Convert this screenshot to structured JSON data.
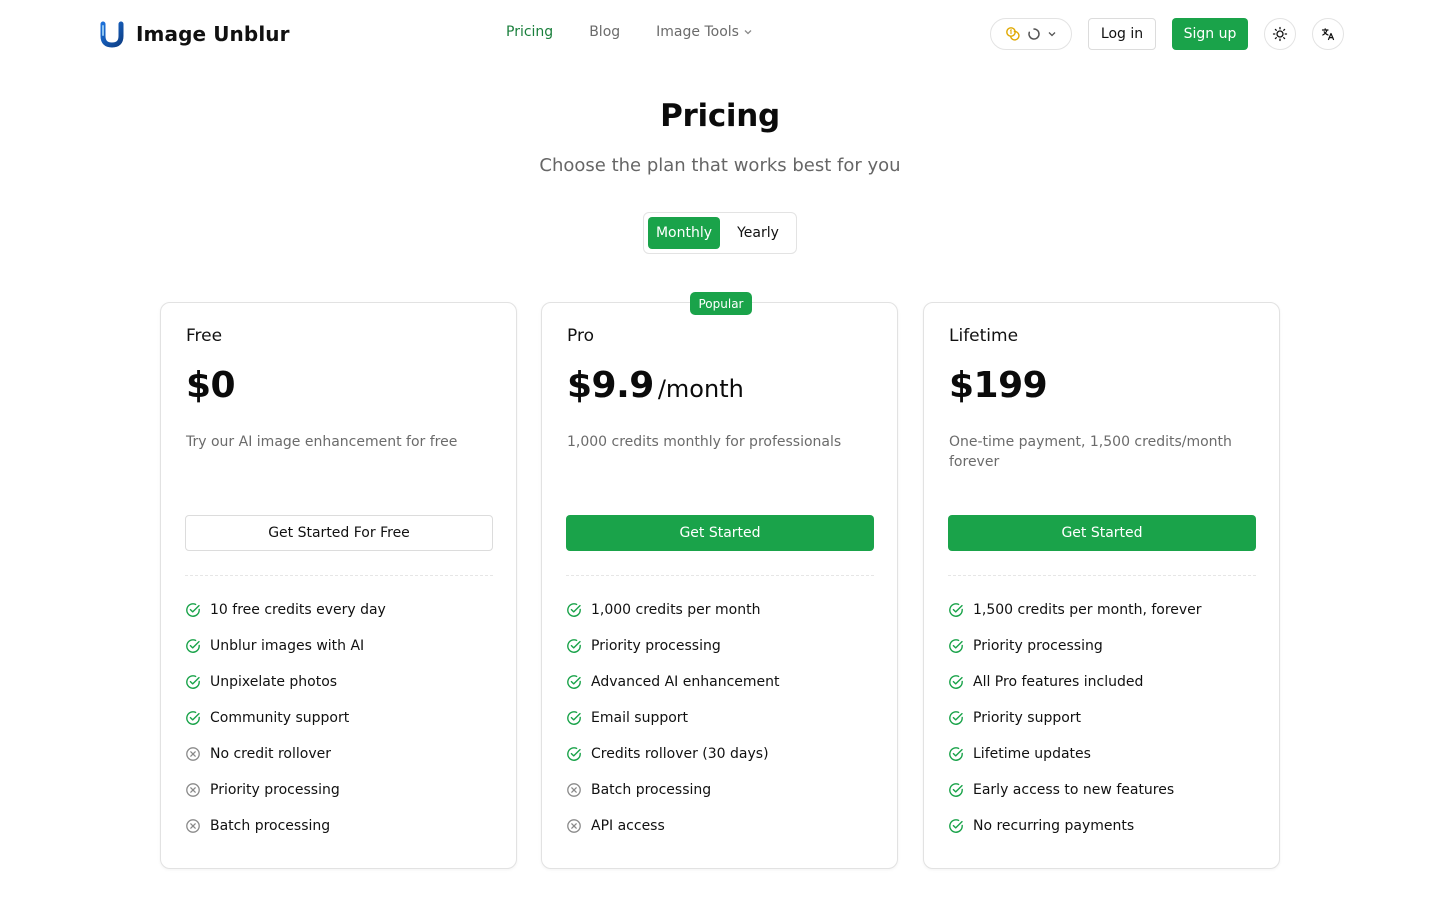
{
  "header": {
    "brand": "Image Unblur",
    "nav": [
      {
        "label": "Pricing",
        "active": true
      },
      {
        "label": "Blog",
        "active": false
      },
      {
        "label": "Image Tools",
        "active": false
      }
    ],
    "credits_icon": "coins-icon",
    "login_label": "Log in",
    "signup_label": "Sign up"
  },
  "hero": {
    "title": "Pricing",
    "subtitle": "Choose the plan that works best for you"
  },
  "billing": {
    "monthly": "Monthly",
    "yearly": "Yearly",
    "selected": "Monthly"
  },
  "colors": {
    "accent": "#1aa34a",
    "accent_text": "#1a7f3c",
    "excluded": "#8a8a8a"
  },
  "plans": [
    {
      "name": "Free",
      "price": "$0",
      "period": "",
      "description": "Try our AI image enhancement for free",
      "cta": "Get Started For Free",
      "features": [
        {
          "text": "10 free credits every day",
          "included": true
        },
        {
          "text": "Unblur images with AI",
          "included": true
        },
        {
          "text": "Unpixelate photos",
          "included": true
        },
        {
          "text": "Community support",
          "included": true
        },
        {
          "text": "No credit rollover",
          "included": false
        },
        {
          "text": "Priority processing",
          "included": false
        },
        {
          "text": "Batch processing",
          "included": false
        }
      ]
    },
    {
      "name": "Pro",
      "badge": "Popular",
      "price": "$9.9",
      "period": "/month",
      "description": "1,000 credits monthly for professionals",
      "cta": "Get Started",
      "features": [
        {
          "text": "1,000 credits per month",
          "included": true
        },
        {
          "text": "Priority processing",
          "included": true
        },
        {
          "text": "Advanced AI enhancement",
          "included": true
        },
        {
          "text": "Email support",
          "included": true
        },
        {
          "text": "Credits rollover (30 days)",
          "included": true
        },
        {
          "text": "Batch processing",
          "included": false
        },
        {
          "text": "API access",
          "included": false
        }
      ]
    },
    {
      "name": "Lifetime",
      "price": "$199",
      "period": "",
      "description": "One-time payment, 1,500 credits/month forever",
      "cta": "Get Started",
      "features": [
        {
          "text": "1,500 credits per month, forever",
          "included": true
        },
        {
          "text": "Priority processing",
          "included": true
        },
        {
          "text": "All Pro features included",
          "included": true
        },
        {
          "text": "Priority support",
          "included": true
        },
        {
          "text": "Lifetime updates",
          "included": true
        },
        {
          "text": "Early access to new features",
          "included": true
        },
        {
          "text": "No recurring payments",
          "included": true
        }
      ]
    }
  ]
}
